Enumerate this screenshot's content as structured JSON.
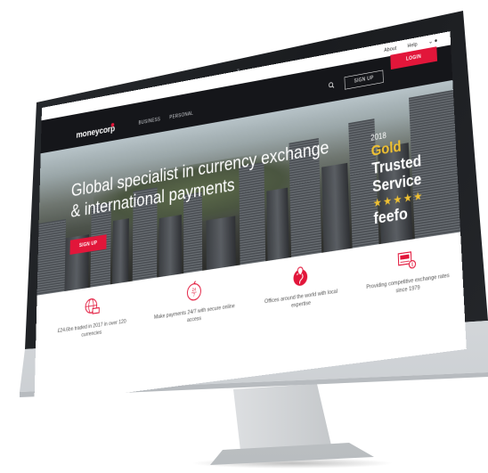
{
  "topbar": {
    "about": "About",
    "help": "Help"
  },
  "nav": {
    "logo": "moneycorp",
    "items": [
      "BUSINESS",
      "PERSONAL"
    ],
    "signup_label": "SIGN UP",
    "login_label": "LOGIN"
  },
  "hero": {
    "title": "Global specialist in currency exchange & international payments",
    "signup_label": "SIGN UP"
  },
  "badge": {
    "year": "2018",
    "line1": "Gold",
    "line2": "Trusted",
    "line3": "Service",
    "stars": "★★★★★",
    "brand": "feefo"
  },
  "features": [
    {
      "icon": "globe-money-icon",
      "text": "£24.6bn traded in 2017 in over 120 currencies"
    },
    {
      "icon": "24-7-clock-icon",
      "text": "Make payments 24/7 with secure online access"
    },
    {
      "icon": "location-globe-icon",
      "text": "Offices around the world with local expertise"
    },
    {
      "icon": "exchange-rate-icon",
      "text": "Providing competitive exchange rates since 1979"
    }
  ],
  "colors": {
    "accent": "#e2163a",
    "nav_bg": "#15161a",
    "gold": "#f1c232"
  }
}
